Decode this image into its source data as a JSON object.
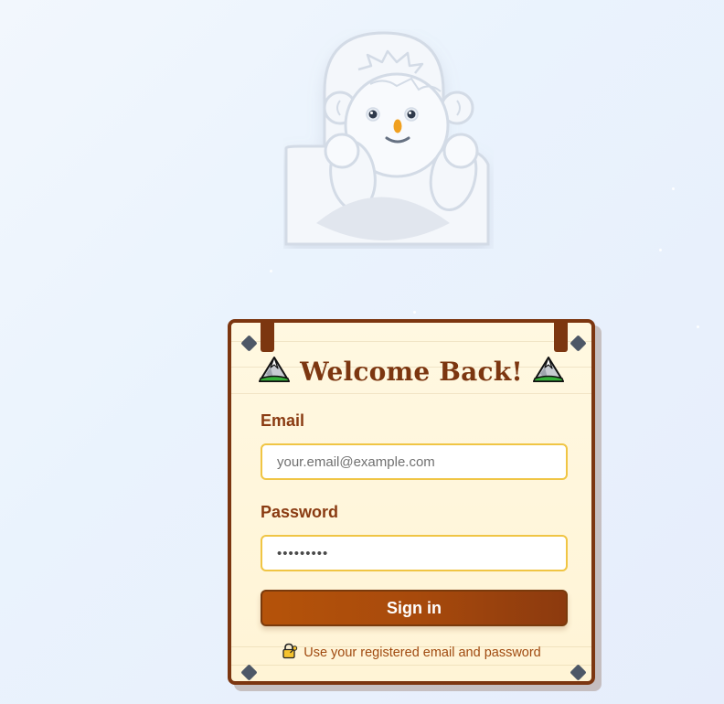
{
  "login_card": {
    "title": "Welcome Back!",
    "title_icon": "mountain-icon",
    "email": {
      "label": "Email",
      "placeholder": "your.email@example.com",
      "value": ""
    },
    "password": {
      "label": "Password",
      "value": "•••••••••"
    },
    "submit_label": "Sign in",
    "hint_icon": "lock-with-key-icon",
    "hint_text": "Use your registered email and password"
  },
  "mascot": {
    "icon": "yeti-mascot-icon"
  },
  "colors": {
    "wood": "#7c3610",
    "board": "#fff6dc",
    "input_border": "#f0c544",
    "button": "#a84a0c",
    "bolt": "#4d5767"
  }
}
